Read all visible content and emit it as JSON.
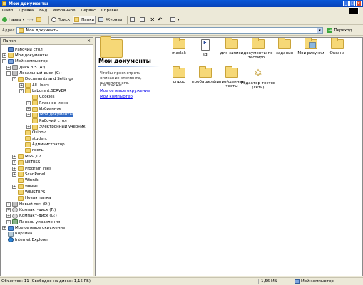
{
  "window": {
    "title": "Мои документы"
  },
  "menu": [
    "Файл",
    "Правка",
    "Вид",
    "Избранное",
    "Сервис",
    "Справка"
  ],
  "toolbar": {
    "back": "Назад",
    "search": "Поиск",
    "folders": "Папки",
    "history": "Журнал"
  },
  "address": {
    "label": "Адрес",
    "value": "Мои документы",
    "go": "Переход"
  },
  "folders_panel": {
    "title": "Папки",
    "tree": [
      {
        "label": "Рабочий стол",
        "icon": "desk",
        "pm": ""
      },
      {
        "label": "Мои документы",
        "icon": "folder",
        "pm": "+"
      },
      {
        "label": "Мой компьютер",
        "icon": "comp",
        "pm": "-"
      },
      {
        "label": "Диск 3,5 (A:)",
        "icon": "drive",
        "pm": "+"
      },
      {
        "label": "Локальный диск (C:)",
        "icon": "drive",
        "pm": "-"
      },
      {
        "label": "Documents and Settings",
        "icon": "folder",
        "pm": "-"
      },
      {
        "label": "All Users",
        "icon": "folder",
        "pm": "+"
      },
      {
        "label": "Laborant.SERVER",
        "icon": "folder",
        "pm": "-"
      },
      {
        "label": "Cookies",
        "icon": "folder",
        "pm": ""
      },
      {
        "label": "Главное меню",
        "icon": "folder",
        "pm": "+"
      },
      {
        "label": "Избранное",
        "icon": "folder",
        "pm": "+"
      },
      {
        "label": "Мои документы",
        "icon": "folder",
        "pm": "+"
      },
      {
        "label": "Рабочий стол",
        "icon": "folder",
        "pm": ""
      },
      {
        "label": "Электронный учебник",
        "icon": "folder",
        "pm": "+"
      },
      {
        "label": "Osipov",
        "icon": "folder",
        "pm": ""
      },
      {
        "label": "student",
        "icon": "folder",
        "pm": ""
      },
      {
        "label": "Администратор",
        "icon": "folder",
        "pm": ""
      },
      {
        "label": "гость",
        "icon": "folder",
        "pm": ""
      },
      {
        "label": "MSSQL7",
        "icon": "folder",
        "pm": "+"
      },
      {
        "label": "NETESS",
        "icon": "folder",
        "pm": "+"
      },
      {
        "label": "Program Files",
        "icon": "folder",
        "pm": "+"
      },
      {
        "label": "ScanPanel",
        "icon": "folder",
        "pm": "+"
      },
      {
        "label": "Winnik",
        "icon": "folder",
        "pm": ""
      },
      {
        "label": "WINNT",
        "icon": "folder",
        "pm": "+"
      },
      {
        "label": "WINSTEPS",
        "icon": "folder",
        "pm": ""
      },
      {
        "label": "Новая папка",
        "icon": "folder",
        "pm": ""
      },
      {
        "label": "Новый том (D:)",
        "icon": "drive",
        "pm": "+"
      },
      {
        "label": "Компакт-диск (F:)",
        "icon": "cd",
        "pm": "+"
      },
      {
        "label": "Компакт-диск (G:)",
        "icon": "cd",
        "pm": "+"
      },
      {
        "label": "Панель управления",
        "icon": "cp",
        "pm": "+"
      },
      {
        "label": "Мое сетевое окружение",
        "icon": "net",
        "pm": "+"
      },
      {
        "label": "Корзина",
        "icon": "bin",
        "pm": ""
      },
      {
        "label": "Internet Explorer",
        "icon": "ie",
        "pm": ""
      }
    ]
  },
  "info": {
    "title": "Мои документы",
    "hint": "Чтобы просмотреть описание элемента, выделите его.",
    "see_also": "См. также:",
    "link1": "Мое сетевое окружение",
    "link2": "Мой компьютер"
  },
  "items": [
    {
      "label": "maslak",
      "icon": "folder"
    },
    {
      "label": "sql",
      "icon": "file"
    },
    {
      "label": "для записи",
      "icon": "folder"
    },
    {
      "label": "документы по тестиро...",
      "icon": "folder"
    },
    {
      "label": "задания",
      "icon": "folder"
    },
    {
      "label": "Мои рисунки",
      "icon": "img"
    },
    {
      "label": "Оксана",
      "icon": "folder"
    },
    {
      "label": "опрос",
      "icon": "folder"
    },
    {
      "label": "проба делфи",
      "icon": "folder"
    },
    {
      "label": "пройденные тесты",
      "icon": "folder"
    },
    {
      "label": "Редактор тестов (сеть)",
      "icon": "star"
    }
  ],
  "status": {
    "objects": "Объектов: 11 (Свободно на диске: 1,15 ГБ)",
    "size": "1,56 МБ",
    "location": "Мой компьютер"
  }
}
